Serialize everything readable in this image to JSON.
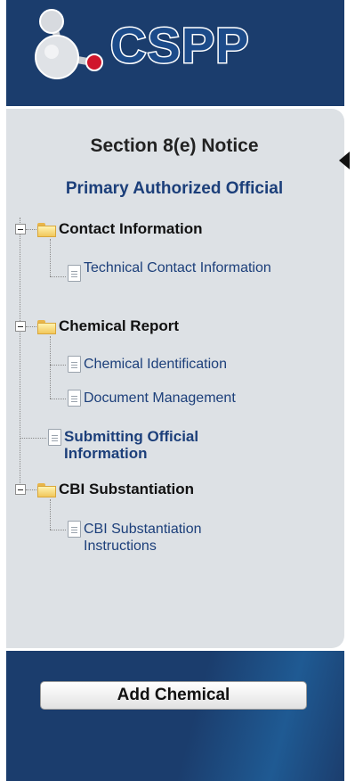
{
  "header": {
    "logo_text": "CSPP",
    "logo_icon": "molecule-icon"
  },
  "panel": {
    "section_title": "Section 8(e) Notice",
    "role_title": "Primary Authorized Official"
  },
  "tree": {
    "contact_information": {
      "label": "Contact Information",
      "children": [
        "Technical Contact Information"
      ]
    },
    "chemical_report": {
      "label": "Chemical Report",
      "children": [
        "Chemical Identification",
        "Document Management"
      ]
    },
    "submitting_official": {
      "label": "Submitting Official Information"
    },
    "cbi_substantiation": {
      "label": "CBI Substantiation",
      "children": [
        "CBI Substantiation Instructions"
      ]
    }
  },
  "footer": {
    "add_chemical_label": "Add Chemical"
  },
  "colors": {
    "navy": "#1b3d6d",
    "panel": "#dde1e5",
    "link": "#1c3f7a"
  }
}
